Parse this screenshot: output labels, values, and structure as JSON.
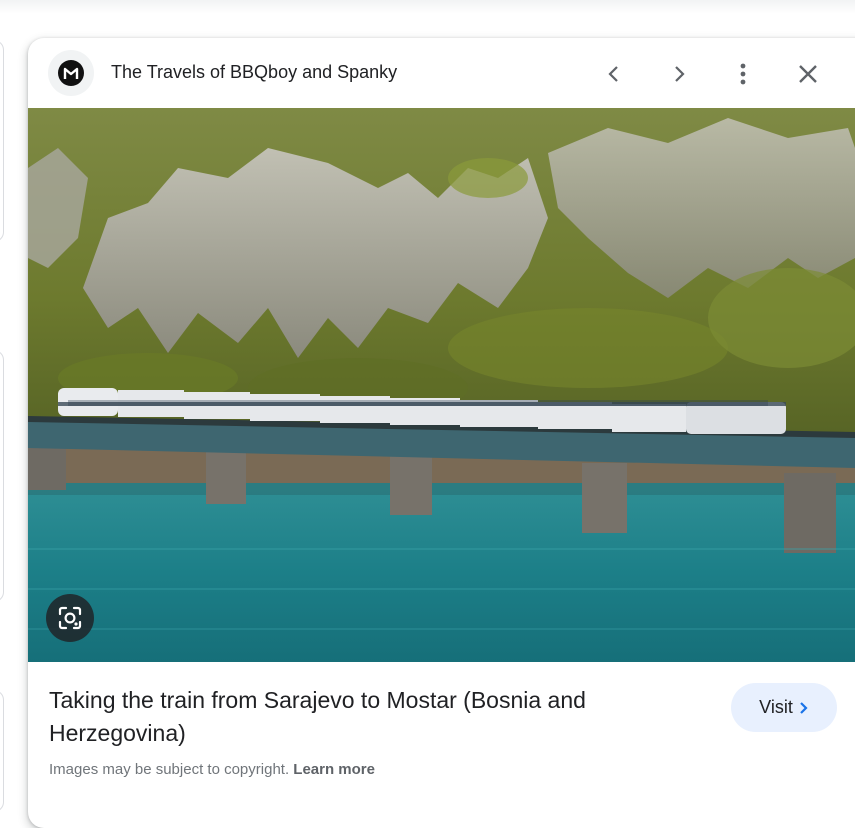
{
  "source": {
    "title": "The Travels of BBQboy and Spanky",
    "favicon": "travel-logo-icon"
  },
  "header_icons": {
    "previous": "chevron-left-icon",
    "next": "chevron-right-icon",
    "more": "more-vert-icon",
    "close": "close-icon"
  },
  "image": {
    "lens_icon": "google-lens-icon"
  },
  "caption": {
    "title": "Taking the train from Sarajevo to Mostar (Bosnia and Herzegovina)"
  },
  "visit_button": {
    "label": "Visit",
    "icon": "chevron-right-icon",
    "color": "#1a73e8"
  },
  "footer": {
    "copyright_text": "Images may be subject to copyright.",
    "learn_more": "Learn more"
  },
  "colors": {
    "visit_bg": "#e8f0fe",
    "accent": "#1a73e8"
  }
}
